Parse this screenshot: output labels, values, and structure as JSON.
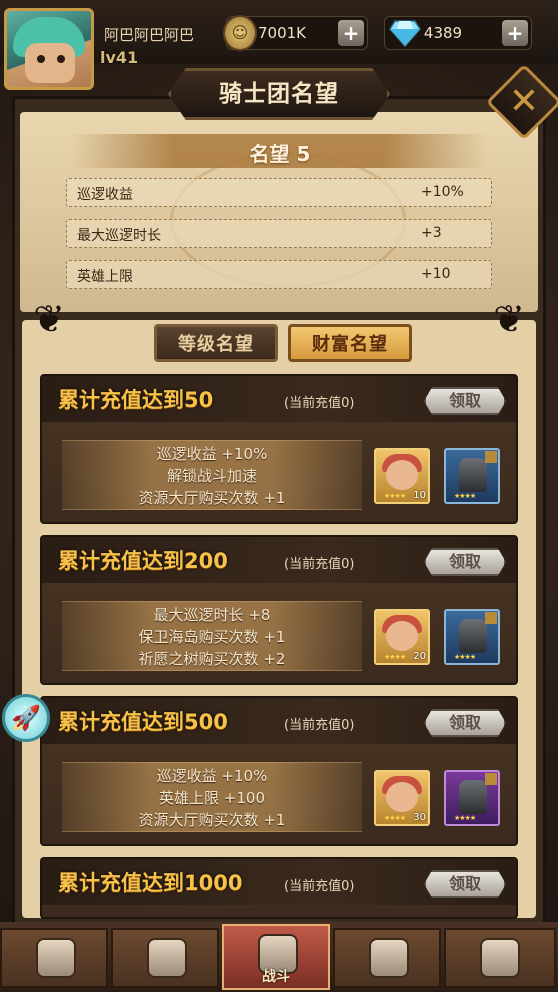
{
  "top_bar": {
    "username": "阿巴阿巴阿巴",
    "level": "lv41",
    "gold": "7001K",
    "gems": "4389",
    "plus_label": "+",
    "coin_glyph": "☺"
  },
  "panel": {
    "title": "骑士团名望",
    "close_glyph": "✕",
    "fame_title": "名望 5",
    "stats": [
      {
        "label": "巡逻收益",
        "value": "+10%"
      },
      {
        "label": "最大巡逻时长",
        "value": "+3"
      },
      {
        "label": "英雄上限",
        "value": "+10"
      }
    ],
    "tabs": {
      "level": "等级名望",
      "wealth": "财富名望"
    }
  },
  "cards": [
    {
      "goal": "累计充值达到50",
      "current": "(当前充值0)",
      "claim": "领取",
      "rewards": [
        "巡逻收益 +10%",
        "解锁战斗加速",
        "资源大厅购买次数 +1"
      ],
      "hero_count": "10",
      "stars": "★★★★"
    },
    {
      "goal": "累计充值达到200",
      "current": "(当前充值0)",
      "claim": "领取",
      "rewards": [
        "最大巡逻时长 +8",
        "保卫海岛购买次数 +1",
        "祈愿之树购买次数 +2"
      ],
      "hero_count": "20",
      "stars": "★★★★"
    },
    {
      "goal": "累计充值达到500",
      "current": "(当前充值0)",
      "claim": "领取",
      "rewards": [
        "巡逻收益 +10%",
        "英雄上限 +100",
        "资源大厅购买次数 +1"
      ],
      "hero_count": "30",
      "stars": "★★★★"
    },
    {
      "goal": "累计充值达到1000",
      "current": "(当前充值0)",
      "claim": "领取"
    }
  ],
  "nav": {
    "active_label": "战斗"
  },
  "rocket_glyph": "🚀"
}
